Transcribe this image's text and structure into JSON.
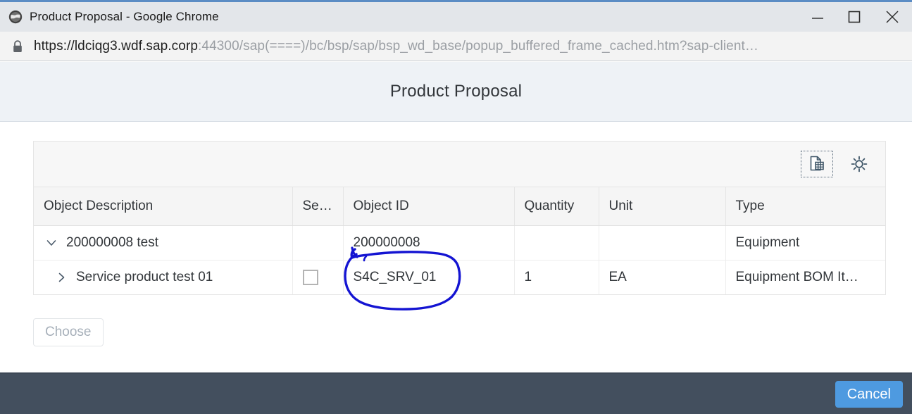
{
  "browser": {
    "title": "Product Proposal - Google Chrome",
    "favicon_icon": "globe-icon",
    "lock_icon": "padlock-icon",
    "url_prefix": "https://",
    "url_host": "ldciqg3.wdf.sap.corp",
    "url_rest": ":44300/sap(====)/bc/bsp/sap/bsp_wd_base/popup_buffered_frame_cached.htm?sap-client…",
    "controls": {
      "minimize": "minimize-icon",
      "maximize": "maximize-icon",
      "close": "close-icon"
    }
  },
  "page": {
    "title": "Product Proposal"
  },
  "toolbar": {
    "export_icon": "spreadsheet-export-icon",
    "settings_icon": "gear-icon"
  },
  "table": {
    "columns": [
      "Object Description",
      "Se…",
      "Object ID",
      "Quantity",
      "Unit",
      "Type"
    ],
    "rows": [
      {
        "expander_icon": "chevron-down-icon",
        "description": "200000008 test",
        "selected": "",
        "object_id": "200000008",
        "quantity": "",
        "unit": "",
        "type": "Equipment"
      },
      {
        "expander_icon": "chevron-right-icon",
        "description": "Service product test 01",
        "selected": "unchecked",
        "object_id": "S4C_SRV_01",
        "quantity": "1",
        "unit": "EA",
        "type": "Equipment BOM It…"
      }
    ]
  },
  "actions": {
    "choose_label": "Choose",
    "cancel_label": "Cancel"
  },
  "annotation": {
    "shape": "hand-drawn-ellipse",
    "color": "#1414d2",
    "targets": "S4C_SRV_01"
  },
  "colors": {
    "footer_bg": "#434f5e",
    "cancel_bg": "#4e9ae0",
    "header_band": "#eef2f6",
    "titlebar_accent": "#5b8cc4"
  }
}
